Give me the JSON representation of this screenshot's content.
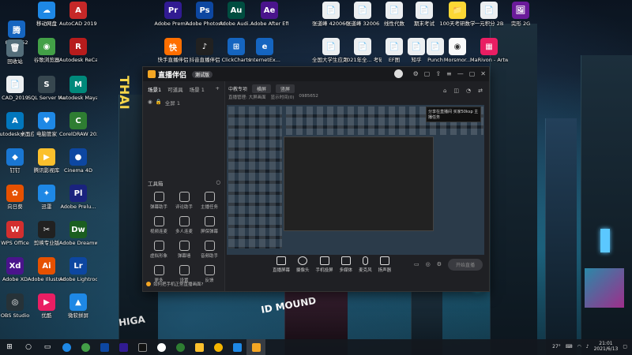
{
  "desktop": {
    "icons": [
      {
        "label": "移动网盘",
        "glyph": "☁",
        "color": "#1e88e5"
      },
      {
        "label": "AutoCAD 2019 -",
        "glyph": "A",
        "color": "#c62828"
      },
      {
        "label": "0985652",
        "glyph": "腾",
        "color": "#1565c0"
      },
      {
        "label": "谷歌浏览器",
        "glyph": "◉",
        "color": "#43a047"
      },
      {
        "label": "Autodesk ReCap",
        "glyph": "R",
        "color": "#b71c1c"
      },
      {
        "label": "回收站",
        "glyph": "🗑",
        "color": "#546e7a"
      },
      {
        "label": "CAD_2019",
        "glyph": "📄",
        "color": "#eceff1"
      },
      {
        "label": "SQL Server Manage...",
        "glyph": "S",
        "color": "#37474f"
      },
      {
        "label": "Autodesk Maya",
        "glyph": "M",
        "color": "#00897b"
      },
      {
        "label": "Autodesk桌面应用程序",
        "glyph": "A",
        "color": "#0277bd"
      },
      {
        "label": "电脑管家",
        "glyph": "♥",
        "color": "#1e88e5"
      },
      {
        "label": "CorelDRAW 2020 (64...",
        "glyph": "C",
        "color": "#2e7d32"
      },
      {
        "label": "钉钉",
        "glyph": "◆",
        "color": "#1976d2"
      },
      {
        "label": "腾讯影视库",
        "glyph": "▶",
        "color": "#fbc02d"
      },
      {
        "label": "Cinema 4D",
        "glyph": "●",
        "color": "#0d47a1"
      },
      {
        "label": "向日葵",
        "glyph": "✿",
        "color": "#e65100"
      },
      {
        "label": "迅雷",
        "glyph": "✦",
        "color": "#1e88e5"
      },
      {
        "label": "Adobe Prelu...",
        "glyph": "Pl",
        "color": "#1a237e"
      },
      {
        "label": "WPS Office",
        "glyph": "W",
        "color": "#d32f2f"
      },
      {
        "label": "剪映专业版",
        "glyph": "✂",
        "color": "#212121"
      },
      {
        "label": "Adobe Dreamwe...",
        "glyph": "Dw",
        "color": "#1b5e20"
      },
      {
        "label": "Adobe XD",
        "glyph": "Xd",
        "color": "#4a148c"
      },
      {
        "label": "Adobe Illustrat...",
        "glyph": "Ai",
        "color": "#e65100"
      },
      {
        "label": "Adobe Lightroo...",
        "glyph": "Lr",
        "color": "#0d47a1"
      },
      {
        "label": "OBS Studio",
        "glyph": "◎",
        "color": "#263238"
      },
      {
        "label": "优酷",
        "glyph": "▶",
        "color": "#e91e63"
      },
      {
        "label": "微软拼屏",
        "glyph": "▲",
        "color": "#1e88e5"
      },
      {
        "label": "Adobe Premi...",
        "glyph": "Pr",
        "color": "#311b92"
      },
      {
        "label": "Adobe Photosh...",
        "glyph": "Ps",
        "color": "#0d47a1"
      },
      {
        "label": "Adobe Audi...",
        "glyph": "Au",
        "color": "#004d40"
      },
      {
        "label": "Adobe After Effects CC...",
        "glyph": "Ae",
        "color": "#4a148c"
      },
      {
        "label": "快手直播伴侣",
        "glyph": "快",
        "color": "#ff6f00"
      },
      {
        "label": "抖音直播伴侣",
        "glyph": "♪",
        "color": "#212121"
      },
      {
        "label": "ClickCharts",
        "glyph": "⊞",
        "color": "#1565c0"
      },
      {
        "label": "InternetEx...",
        "glyph": "e",
        "color": "#1565c0"
      },
      {
        "label": "张道峰 42006017",
        "glyph": "📄",
        "color": "#eceff1"
      },
      {
        "label": "张道峰 32006",
        "glyph": "📄",
        "color": "#eceff1"
      },
      {
        "label": "线性代数",
        "glyph": "📄",
        "color": "#eceff1"
      },
      {
        "label": "期末考试",
        "glyph": "📄",
        "color": "#eceff1"
      },
      {
        "label": "100天考研数学",
        "glyph": "📁",
        "color": "#fdd835"
      },
      {
        "label": "一元积分 2B",
        "glyph": "📄",
        "color": "#eceff1"
      },
      {
        "label": "完形 2G",
        "glyph": "🖼",
        "color": "#6a1b9a"
      },
      {
        "label": "全国大学生应用...",
        "glyph": "📄",
        "color": "#eceff1"
      },
      {
        "label": "2021年全... 考研",
        "glyph": "📄",
        "color": "#eceff1"
      },
      {
        "label": "EF图",
        "glyph": "📄",
        "color": "#eceff1"
      },
      {
        "label": "知乎",
        "glyph": "📄",
        "color": "#eceff1"
      },
      {
        "label": "Punch",
        "glyph": "📄",
        "color": "#eceff1"
      },
      {
        "label": "Morsmor...",
        "glyph": "◉",
        "color": "#fafafa"
      },
      {
        "label": "MaRivon - Artwork...",
        "glyph": "▦",
        "color": "#e91e63"
      }
    ]
  },
  "app": {
    "name": "直播伴侣",
    "version": "测试版",
    "scene_tabs": [
      "场景1",
      "可道具",
      "场景 1"
    ],
    "scene_row": [
      "全屏 1"
    ],
    "tools_title": "工具箱",
    "tools": [
      {
        "label": "弹幕助手"
      },
      {
        "label": "评论助手"
      },
      {
        "label": "主播任务"
      },
      {
        "label": "视频连麦"
      },
      {
        "label": "多人连麦"
      },
      {
        "label": "屏保弹幕"
      },
      {
        "label": "虚拟形象"
      },
      {
        "label": "弹幕墙"
      },
      {
        "label": "音频助手"
      },
      {
        "label": "更多"
      },
      {
        "label": "设置"
      },
      {
        "label": "反馈"
      }
    ],
    "hint": "如何把手机正常直播画面?",
    "top_row": [
      "中教专项",
      "横屏",
      "竖屏"
    ],
    "top_row2": [
      "直播管理: 大屏画面",
      "显示时间(0)",
      "0985652"
    ],
    "notif": "分享在直播间 买家50ksp 主播任务",
    "bottom": [
      {
        "label": "直播屏幕"
      },
      {
        "label": "摄像头"
      },
      {
        "label": "手机投屏"
      },
      {
        "label": "多媒体"
      },
      {
        "label": "麦克风"
      },
      {
        "label": "扬声器"
      }
    ],
    "live_button": "开始直播"
  },
  "taskbar": {
    "time": "21:01",
    "date": "2021/6/13",
    "weather": "27°"
  }
}
